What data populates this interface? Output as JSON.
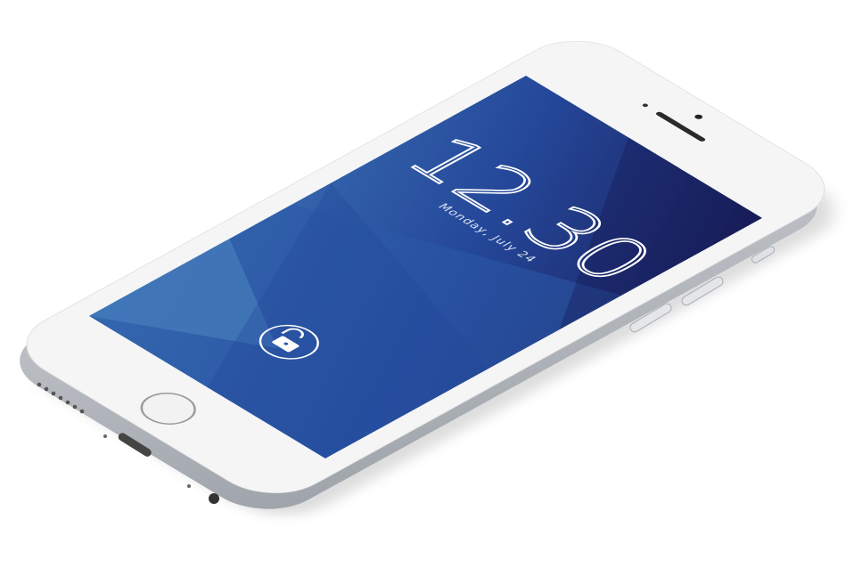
{
  "lock_screen": {
    "time": "12.30",
    "date": "Monday, July 24",
    "lock_icon": "unlocked-padlock-icon"
  },
  "device": {
    "home_button_icon": "home-button-icon",
    "camera_icon": "front-camera-icon",
    "speaker_icon": "earpiece-speaker-icon"
  },
  "colors": {
    "screen_light": "#3f78b8",
    "screen_mid": "#25489a",
    "screen_dark": "#1a1f5c",
    "body": "#f5f5f5",
    "edge": "#b8bcc2"
  }
}
